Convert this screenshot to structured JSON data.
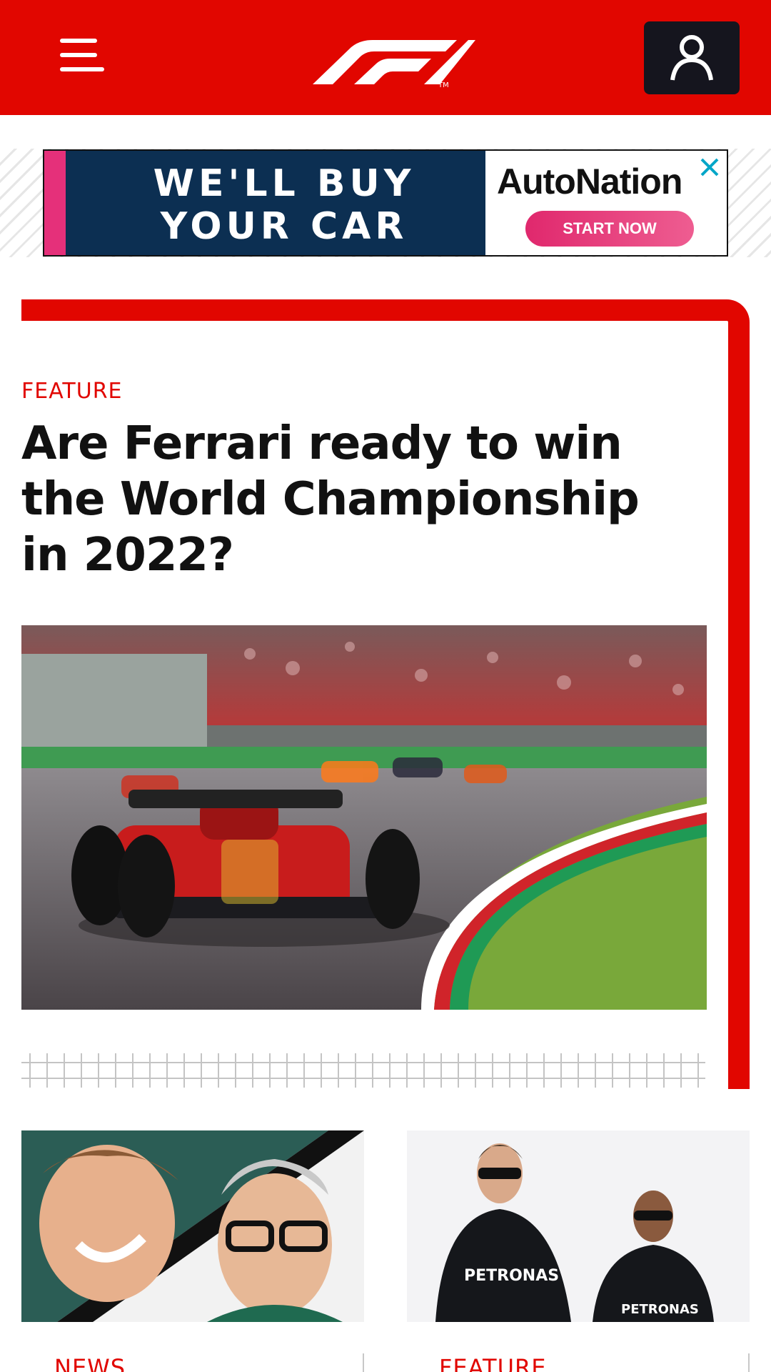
{
  "header": {
    "menu_icon": "hamburger-menu-icon",
    "logo": "f1-logo",
    "account_icon": "user-account-icon",
    "brand_color": "#e10600"
  },
  "ad": {
    "headline_line1": "WE'LL BUY",
    "headline_line2": "YOUR CAR",
    "brand": "AutoNation",
    "cta": "START NOW",
    "close_icon": "close-icon"
  },
  "feature": {
    "tag": "FEATURE",
    "title_line1": "Are Ferrari ready to win",
    "title_line2": "the World Championship",
    "title_line3": "in 2022?",
    "image": "ferrari-car-on-track-photo"
  },
  "cards": [
    {
      "tag": "NEWS",
      "image": "vettel-and-team-principal-photo"
    },
    {
      "tag": "FEATURE",
      "image": "mercedes-drivers-photo"
    }
  ]
}
